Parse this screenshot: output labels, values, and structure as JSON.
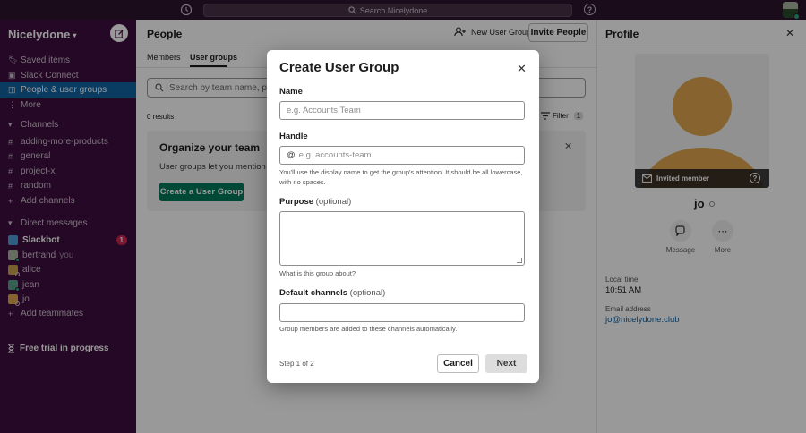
{
  "topbar": {
    "search_placeholder": "Search Nicelydone",
    "history_icon": "clock-icon",
    "help_icon": "help-icon"
  },
  "sidebar": {
    "workspace": "Nicelydone",
    "top_items": [
      {
        "icon": "bookmark-icon",
        "label": "Saved items"
      },
      {
        "icon": "building-icon",
        "label": "Slack Connect"
      },
      {
        "icon": "people-icon",
        "label": "People & user groups"
      },
      {
        "icon": "more-vertical-icon",
        "label": "More"
      }
    ],
    "channels_header": "Channels",
    "channels": [
      "adding-more-products",
      "general",
      "project-x",
      "random"
    ],
    "add_channels": "Add channels",
    "dm_header": "Direct messages",
    "dms": [
      {
        "name": "Slackbot",
        "you": "",
        "badge": "1"
      },
      {
        "name": "bertrand",
        "you": "you",
        "badge": ""
      },
      {
        "name": "alice",
        "you": "",
        "badge": ""
      },
      {
        "name": "jean",
        "you": "",
        "badge": ""
      },
      {
        "name": "jo",
        "you": "",
        "badge": ""
      }
    ],
    "add_teammates": "Add teammates",
    "trial": "Free trial in progress"
  },
  "main": {
    "title": "People",
    "new_group": "New User Group",
    "invite": "Invite People",
    "tabs": [
      "Members",
      "User groups"
    ],
    "search_placeholder": "Search by team name, project",
    "results": "0 results",
    "filter": "Filter",
    "filter_count": "1",
    "card_title": "Organize your team",
    "card_desc": "User groups let you mention de",
    "card_button": "Create a User Group"
  },
  "profile": {
    "title": "Profile",
    "invited": "Invited member",
    "name": "jo",
    "message": "Message",
    "more": "More",
    "local_time_label": "Local time",
    "local_time": "10:51 AM",
    "email_label": "Email address",
    "email": "jo@nicelydone.club"
  },
  "modal": {
    "title": "Create User Group",
    "name_label": "Name",
    "name_placeholder": "e.g. Accounts Team",
    "handle_label": "Handle",
    "handle_placeholder": "e.g. accounts-team",
    "handle_hint": "You'll use the display name to get the group's attention. It should be all lowercase, with no spaces.",
    "purpose_label": "Purpose",
    "purpose_opt": "(optional)",
    "purpose_hint": "What is this group about?",
    "channels_label": "Default channels",
    "channels_opt": "(optional)",
    "channels_hint": "Group members are added to these channels automatically.",
    "step": "Step 1 of 2",
    "cancel": "Cancel",
    "next": "Next"
  },
  "colors": {
    "sidebar_bg": "#3f0e40",
    "topbar_bg": "#2e1430",
    "active": "#1264a3",
    "primary_btn": "#007a5a",
    "badge": "#cd2553"
  }
}
